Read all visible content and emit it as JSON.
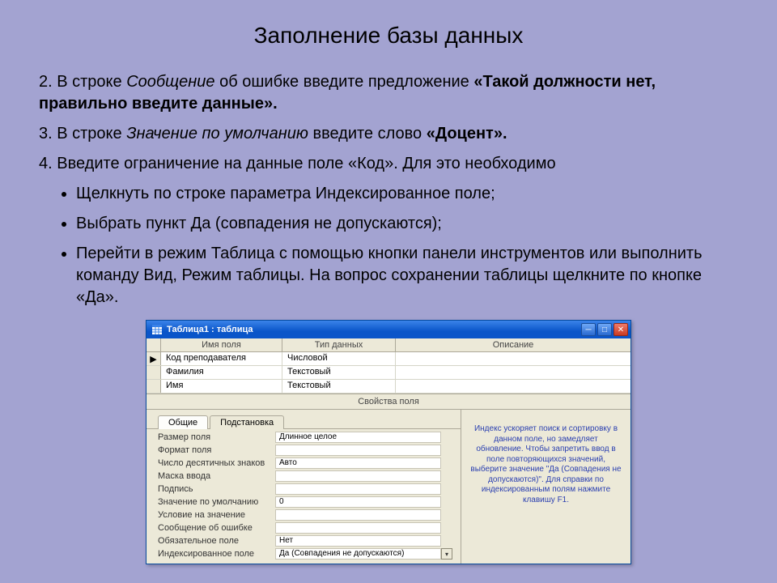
{
  "title": "Заполнение базы данных",
  "step2_prefix": "2. В строке ",
  "step2_italic": "Сообщение",
  "step2_mid": " об ошибке введите предложение ",
  "step2_bold": "«Такой должности нет, правильно введите данные».",
  "step3_prefix": "3. В строке ",
  "step3_italic": "Значение по умолчанию",
  "step3_mid": " введите слово ",
  "step3_bold": "«Доцент».",
  "step4": "4. Введите ограничение на данные поле «Код». Для это необходимо",
  "b1": "Щелкнуть по строке параметра Индексированное поле;",
  "b2": "Выбрать пункт Да (совпадения не допускаются);",
  "b3": "Перейти в режим Таблица с помощью кнопки панели инструментов или выполнить команду Вид, Режим таблицы. На вопрос сохранении таблицы щелкните по кнопке «Да».",
  "window": {
    "title": "Таблица1 : таблица",
    "headers": {
      "c1": "Имя поля",
      "c2": "Тип данных",
      "c3": "Описание"
    },
    "rows": [
      {
        "sel": "▶",
        "f": "Код преподавателя",
        "t": "Числовой",
        "d": ""
      },
      {
        "sel": "",
        "f": "Фамилия",
        "t": "Текстовый",
        "d": ""
      },
      {
        "sel": "",
        "f": "Имя",
        "t": "Текстовый",
        "d": ""
      }
    ],
    "propsTitle": "Свойства поля",
    "tabs": {
      "general": "Общие",
      "lookup": "Подстановка"
    },
    "props": [
      {
        "label": "Размер поля",
        "value": "Длинное целое",
        "dd": false
      },
      {
        "label": "Формат поля",
        "value": "",
        "dd": false
      },
      {
        "label": "Число десятичных знаков",
        "value": "Авто",
        "dd": false
      },
      {
        "label": "Маска ввода",
        "value": "",
        "dd": false
      },
      {
        "label": "Подпись",
        "value": "",
        "dd": false
      },
      {
        "label": "Значение по умолчанию",
        "value": "0",
        "dd": false
      },
      {
        "label": "Условие на значение",
        "value": "",
        "dd": false
      },
      {
        "label": "Сообщение об ошибке",
        "value": "",
        "dd": false
      },
      {
        "label": "Обязательное поле",
        "value": "Нет",
        "dd": false
      },
      {
        "label": "Индексированное поле",
        "value": "Да (Совпадения не допускаются)",
        "dd": true
      }
    ],
    "help": "Индекс ускоряет поиск и сортировку в данном поле, но замедляет обновление. Чтобы запретить ввод в поле повторяющихся значений, выберите значение \"Да (Совпадения не допускаются)\". Для справки по индексированным полям нажмите клавишу F1."
  }
}
